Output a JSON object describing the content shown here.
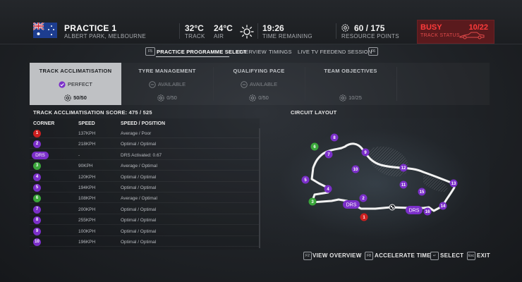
{
  "session": {
    "title": "PRACTICE 1",
    "location": "ALBERT PARK, MELBOURNE",
    "flag_icon": "australia-flag-icon"
  },
  "weather": {
    "track_temp": "32°C",
    "track_label": "TRACK",
    "air_temp": "24°C",
    "air_label": "AIR",
    "icon": "sun-icon"
  },
  "time": {
    "value": "19:26",
    "label": "TIME REMAINING"
  },
  "resources": {
    "value": "60 / 175",
    "label": "RESOURCE POINTS"
  },
  "track_status": {
    "state": "BUSY",
    "count": "10/22",
    "label": "TRACK STATUS",
    "color": "#ff3b3b"
  },
  "nav": {
    "left_key": "F5",
    "right_key": "F6",
    "items": [
      {
        "label": "PRACTICE PROGRAMME SELECT",
        "active": true
      },
      {
        "label": "OVERVIEW",
        "active": false
      },
      {
        "label": "TIMINGS",
        "active": false
      },
      {
        "label": "LIVE TV FEED",
        "active": false
      },
      {
        "label": "END SESSION",
        "active": false
      }
    ]
  },
  "programmes": [
    {
      "title": "TRACK ACCLIMATISATION",
      "status": "PERFECT",
      "points": "50/50",
      "selected": true
    },
    {
      "title": "TYRE MANAGEMENT",
      "status": "AVAILABLE",
      "points": "0/50",
      "selected": false
    },
    {
      "title": "QUALIFYING PACE",
      "status": "AVAILABLE",
      "points": "0/50",
      "selected": false
    },
    {
      "title": "TEAM OBJECTIVES",
      "status": "",
      "points": "10/25",
      "selected": false
    }
  ],
  "score": "TRACK ACCLIMATISATION SCORE: 475 / 525",
  "table": {
    "headers": [
      "CORNER",
      "SPEED",
      "SPEED / POSITION"
    ],
    "rows": [
      {
        "corner": "1",
        "badge": "red",
        "speed": "137KPH",
        "pos": "Average / Poor"
      },
      {
        "corner": "2",
        "badge": "purple",
        "speed": "218KPH",
        "pos": "Optimal / Optimal"
      },
      {
        "corner": "DRS",
        "badge": "drs",
        "speed": "-",
        "pos": "DRS Activated: 0.67"
      },
      {
        "corner": "3",
        "badge": "green",
        "speed": "90KPH",
        "pos": "Average / Optimal"
      },
      {
        "corner": "4",
        "badge": "purple",
        "speed": "120KPH",
        "pos": "Optimal / Optimal"
      },
      {
        "corner": "5",
        "badge": "purple",
        "speed": "194KPH",
        "pos": "Optimal / Optimal"
      },
      {
        "corner": "6",
        "badge": "green",
        "speed": "108KPH",
        "pos": "Average / Optimal"
      },
      {
        "corner": "7",
        "badge": "purple",
        "speed": "200KPH",
        "pos": "Optimal / Optimal"
      },
      {
        "corner": "8",
        "badge": "purple",
        "speed": "255KPH",
        "pos": "Optimal / Optimal"
      },
      {
        "corner": "9",
        "badge": "purple",
        "speed": "100KPH",
        "pos": "Optimal / Optimal"
      },
      {
        "corner": "10",
        "badge": "purple",
        "speed": "196KPH",
        "pos": "Optimal / Optimal"
      }
    ]
  },
  "circuit": {
    "title": "CIRCUIT LAYOUT",
    "markers": [
      {
        "label": "1",
        "color": "red"
      },
      {
        "label": "2",
        "color": "purple"
      },
      {
        "label": "3",
        "color": "green"
      },
      {
        "label": "4",
        "color": "purple"
      },
      {
        "label": "5",
        "color": "purple"
      },
      {
        "label": "6",
        "color": "green"
      },
      {
        "label": "7",
        "color": "purple"
      },
      {
        "label": "8",
        "color": "purple"
      },
      {
        "label": "9",
        "color": "purple"
      },
      {
        "label": "10",
        "color": "purple"
      },
      {
        "label": "11",
        "color": "purple"
      },
      {
        "label": "12",
        "color": "purple"
      },
      {
        "label": "13",
        "color": "purple"
      },
      {
        "label": "14",
        "color": "purple"
      },
      {
        "label": "15",
        "color": "purple"
      },
      {
        "label": "16",
        "color": "purple"
      }
    ],
    "drs_labels": [
      "DRS",
      "DRS"
    ]
  },
  "footer": [
    {
      "key": "F2",
      "label": "VIEW OVERVIEW"
    },
    {
      "key": "F8",
      "label": "ACCELERATE TIME"
    },
    {
      "key": "↵",
      "label": "SELECT"
    },
    {
      "key": "Esc",
      "label": "EXIT"
    }
  ],
  "colors": {
    "purple": "#7b2fc9",
    "green": "#3aa63a",
    "red": "#cc1f1f",
    "selected_tile": "#bfc1c4"
  }
}
